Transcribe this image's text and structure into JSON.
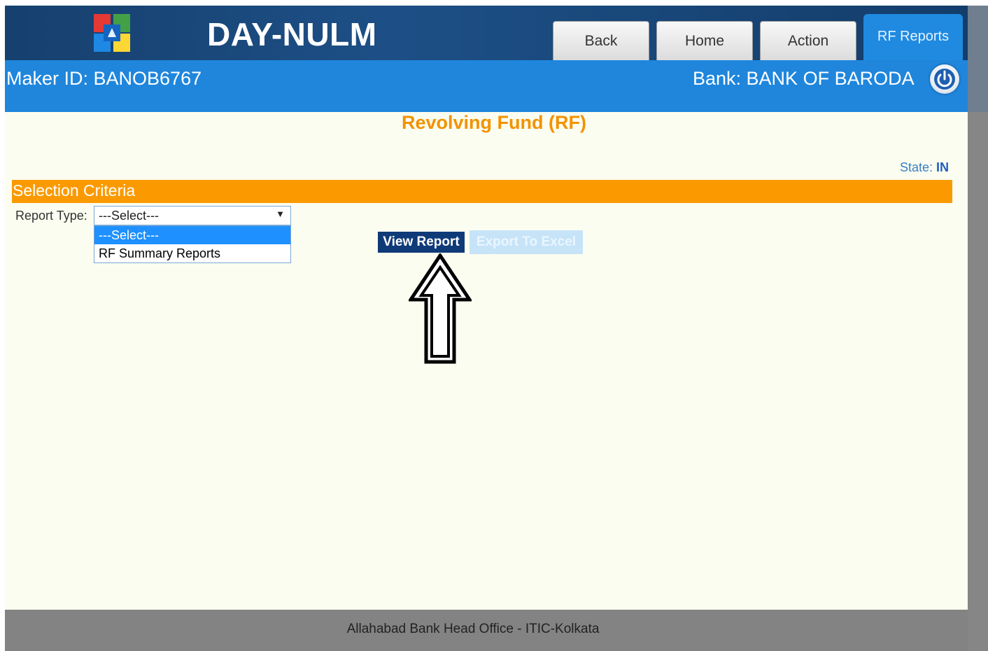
{
  "header": {
    "app_title": "DAY-NULM",
    "tabs": [
      {
        "label": "Back"
      },
      {
        "label": "Home"
      },
      {
        "label": "Action"
      },
      {
        "label": "RF Reports"
      }
    ]
  },
  "subheader": {
    "maker_id": "Maker ID: BANOB6767",
    "bank": "Bank: BANK OF BARODA"
  },
  "main": {
    "page_title": "Revolving Fund (RF)",
    "state_label": "State:",
    "state_value": "IN",
    "criteria_title": "Selection Criteria",
    "report_type_label": "Report Type:",
    "select_value": "---Select---",
    "options": [
      "---Select---",
      "RF Summary Reports"
    ],
    "view_report_label": "View Report",
    "export_label": "Export To Excel"
  },
  "footer": {
    "text": "Allahabad Bank Head Office - ITIC-Kolkata"
  },
  "colors": {
    "header_bg": "#1d4f86",
    "subheader_bg": "#1f86dc",
    "accent_orange": "#fb9a00",
    "view_button": "#0f3a78"
  },
  "icons": [
    "app-logo",
    "power-icon",
    "dropdown-arrow-icon",
    "arrow-annotation"
  ]
}
